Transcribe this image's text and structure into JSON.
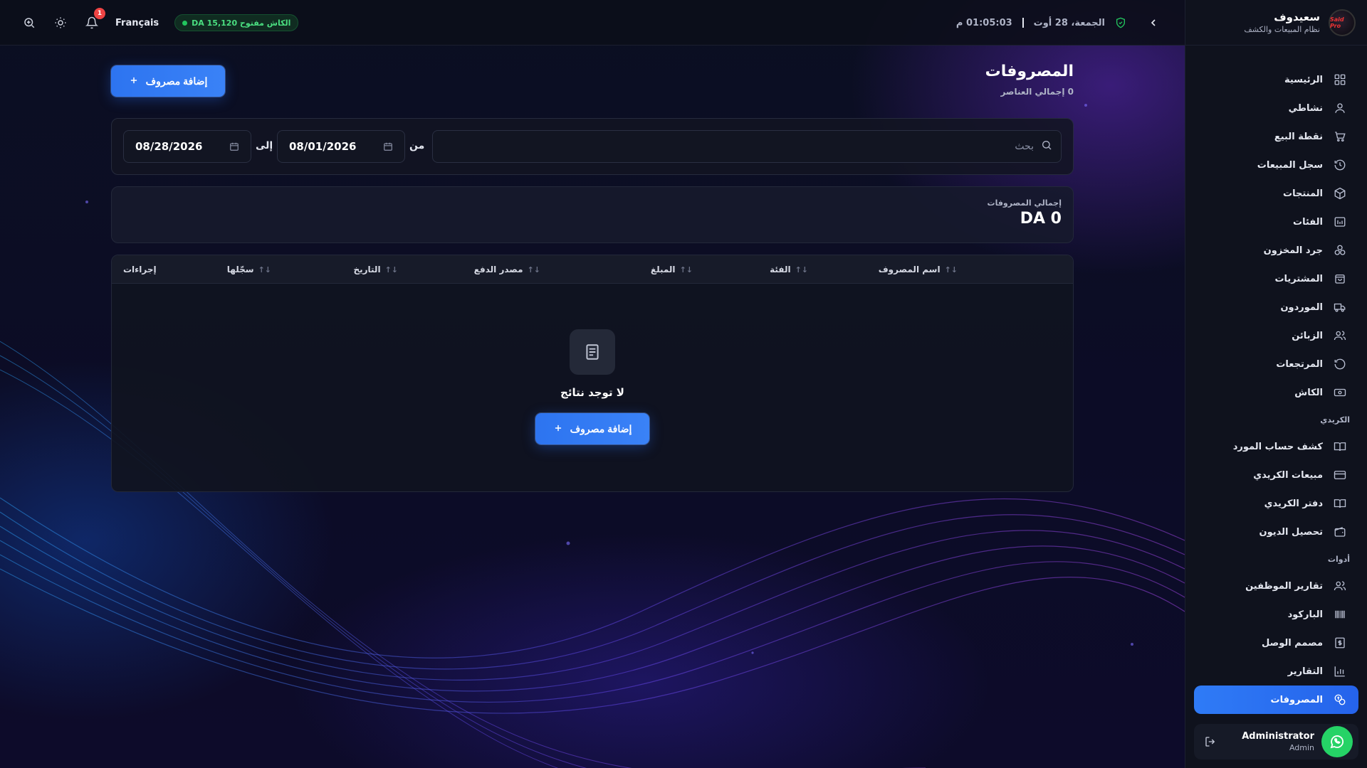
{
  "sidebar": {
    "brand_name": "سعيدوف",
    "brand_sub": "نظام المبيعات والكشف",
    "logo_text": "Said Pro",
    "items": [
      {
        "label": "الرئيسية",
        "icon": "grid-icon"
      },
      {
        "label": "نشاطي",
        "icon": "user-icon"
      },
      {
        "label": "نقطة البيع",
        "icon": "cart-icon"
      },
      {
        "label": "سجل المبيعات",
        "icon": "history-icon"
      },
      {
        "label": "المنتجات",
        "icon": "box-icon"
      },
      {
        "label": "الفئات",
        "icon": "category-icon"
      },
      {
        "label": "جرد المخزون",
        "icon": "stock-icon"
      },
      {
        "label": "المشتريات",
        "icon": "bag-icon"
      },
      {
        "label": "الموردون",
        "icon": "truck-icon"
      },
      {
        "label": "الزبائن",
        "icon": "users-icon"
      },
      {
        "label": "المرتجعات",
        "icon": "return-icon"
      },
      {
        "label": "الكاش",
        "icon": "cash-icon"
      }
    ],
    "section_credit": "الكريدي",
    "credit_items": [
      {
        "label": "كشف حساب المورد",
        "icon": "book-icon"
      },
      {
        "label": "مبيعات الكريدي",
        "icon": "card-icon"
      },
      {
        "label": "دفتر الكريدي",
        "icon": "book-icon"
      },
      {
        "label": "تحصيل الديون",
        "icon": "wallet-icon"
      }
    ],
    "section_tools": "أدوات",
    "tool_items": [
      {
        "label": "تقارير الموظفين",
        "icon": "users-icon"
      },
      {
        "label": "الباركود",
        "icon": "barcode-icon"
      },
      {
        "label": "مصمم الوصل",
        "icon": "receipt-icon"
      },
      {
        "label": "التقارير",
        "icon": "chart-icon"
      }
    ],
    "active_item": {
      "label": "المصروفات",
      "icon": "expenses-icon"
    },
    "user": {
      "name": "Administrator",
      "role": "Admin"
    }
  },
  "topbar": {
    "notification_count": "1",
    "language": "Français",
    "cash_status": "الكاش مفتوح DA 15,120",
    "date": "الجمعة، 28 أوت",
    "time": "01:05:03 م"
  },
  "page": {
    "title": "المصروفات",
    "subtitle": "0 إجمالي العناصر",
    "add_button": "إضافة مصروف"
  },
  "filters": {
    "search_placeholder": "بحث",
    "from_label": "من",
    "to_label": "إلى",
    "from_date": "08/01/2026",
    "to_date": "08/28/2026"
  },
  "summary": {
    "label": "إجمالي المصروفات",
    "value": "DA 0"
  },
  "table": {
    "columns": [
      "اسم المصروف",
      "الفئة",
      "المبلغ",
      "مصدر الدفع",
      "التاريخ",
      "سجّلها",
      "إجراءات"
    ],
    "empty_text": "لا توجد نتائج",
    "empty_button": "إضافة مصروف"
  },
  "colors": {
    "accent": "#2f7bf6",
    "success": "#22c55e",
    "danger": "#ef4444",
    "sidebar_bg": "#0f121d"
  }
}
